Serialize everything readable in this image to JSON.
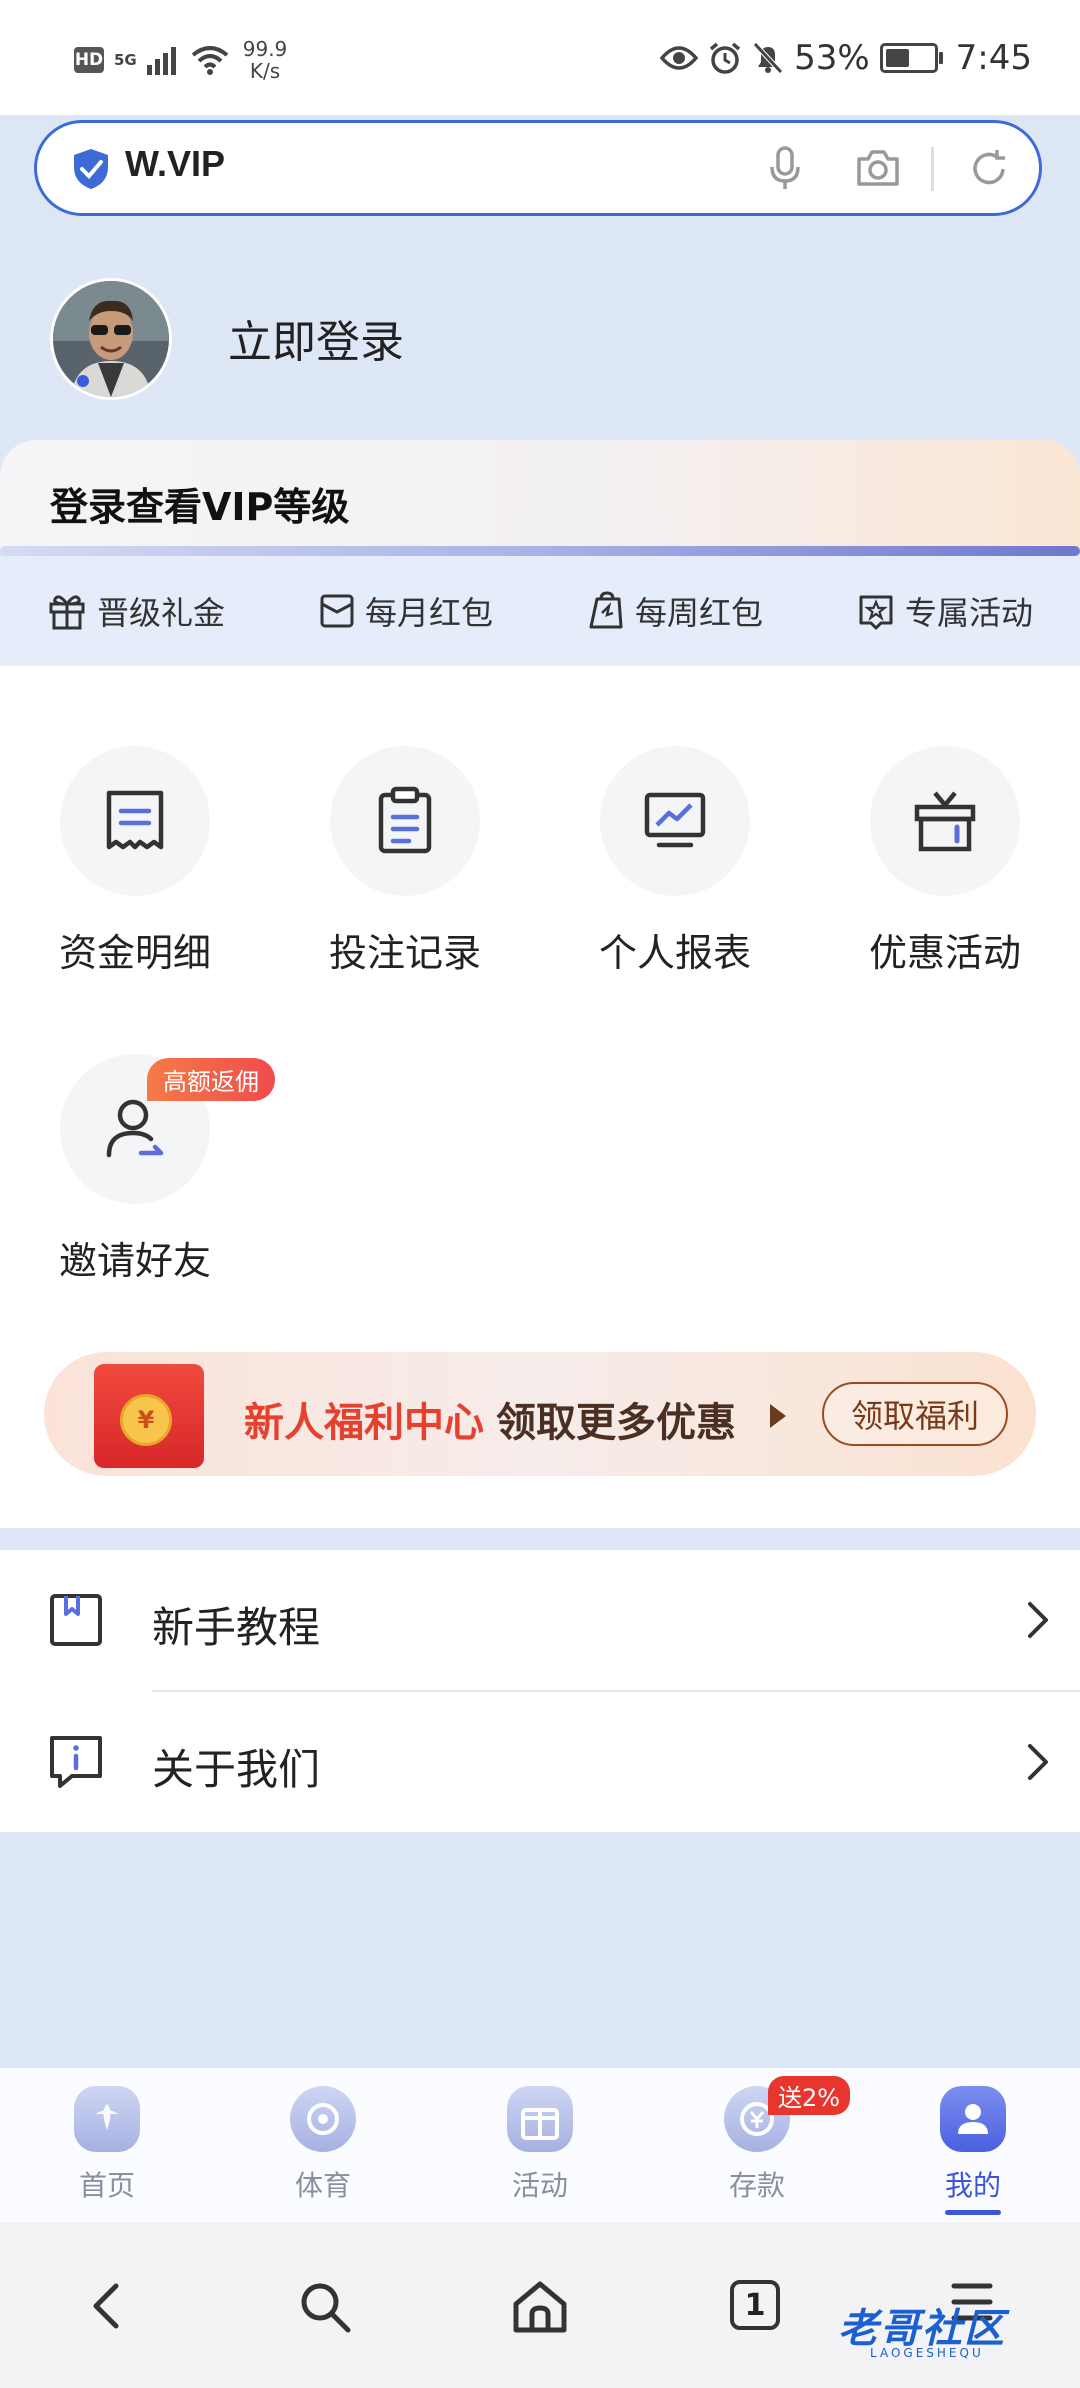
{
  "status_bar": {
    "hd": "HD",
    "network": "5G",
    "speed_value": "99.9",
    "speed_unit": "K/s",
    "battery": "53%",
    "battery_level": 0.53,
    "time": "7:45"
  },
  "address_bar": {
    "url": "W.VIP"
  },
  "user": {
    "login_label": "立即登录"
  },
  "vip": {
    "title": "登录查看VIP等级",
    "perks": [
      {
        "icon": "gift-icon",
        "label": "晋级礼金"
      },
      {
        "icon": "envelope-icon",
        "label": "每月红包"
      },
      {
        "icon": "shopping-bag-icon",
        "label": "每周红包"
      },
      {
        "icon": "star-tag-icon",
        "label": "专属活动"
      }
    ]
  },
  "grid": [
    {
      "icon": "receipt-icon",
      "label": "资金明细"
    },
    {
      "icon": "clipboard-icon",
      "label": "投注记录"
    },
    {
      "icon": "monitor-chart-icon",
      "label": "个人报表"
    },
    {
      "icon": "gift-box-icon",
      "label": "优惠活动"
    },
    {
      "icon": "invite-user-icon",
      "label": "邀请好友",
      "tag": "高额返佣"
    }
  ],
  "banner": {
    "highlight": "新人福利中心",
    "text": "领取更多优惠",
    "button": "领取福利",
    "coin": "¥"
  },
  "menu": [
    {
      "icon": "book-icon",
      "label": "新手教程"
    },
    {
      "icon": "info-icon",
      "label": "关于我们"
    }
  ],
  "tabs": [
    {
      "icon": "home-icon",
      "label": "首页",
      "active": false
    },
    {
      "icon": "sports-icon",
      "label": "体育",
      "active": false
    },
    {
      "icon": "activity-icon",
      "label": "活动",
      "active": false
    },
    {
      "icon": "deposit-icon",
      "label": "存款",
      "active": false,
      "badge": "送2%"
    },
    {
      "icon": "profile-icon",
      "label": "我的",
      "active": true
    }
  ],
  "browser_nav": {
    "tab_count": "1"
  },
  "watermark": {
    "text": "老哥社区",
    "sub": "LAOGESHEQU"
  },
  "colors": {
    "accent": "#3d55d8",
    "border": "#3d6ad6",
    "banner_red": "#e5412f"
  }
}
